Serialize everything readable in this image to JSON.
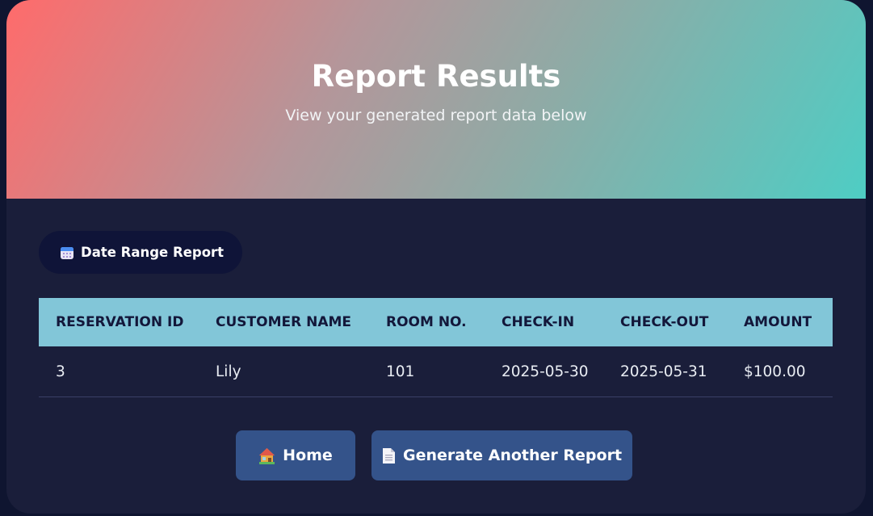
{
  "header": {
    "title": "Report Results",
    "subtitle": "View your generated report data below"
  },
  "badge": {
    "icon": "calendar-icon",
    "label": "Date Range Report"
  },
  "table": {
    "columns": [
      "RESERVATION ID",
      "CUSTOMER NAME",
      "ROOM NO.",
      "CHECK-IN",
      "CHECK-OUT",
      "AMOUNT"
    ],
    "rows": [
      [
        "3",
        "Lily",
        "101",
        "2025-05-30",
        "2025-05-31",
        "$100.00"
      ]
    ]
  },
  "actions": {
    "home": {
      "icon": "house-icon",
      "label": "Home"
    },
    "generate": {
      "icon": "document-icon",
      "label": "Generate Another Report"
    }
  },
  "colors": {
    "gradient_start": "#ff6b6b",
    "gradient_end": "#4ecdc4",
    "card_bg": "#1a1e3a",
    "table_header_bg": "#82c6d8",
    "button_bg": "#34538a"
  }
}
